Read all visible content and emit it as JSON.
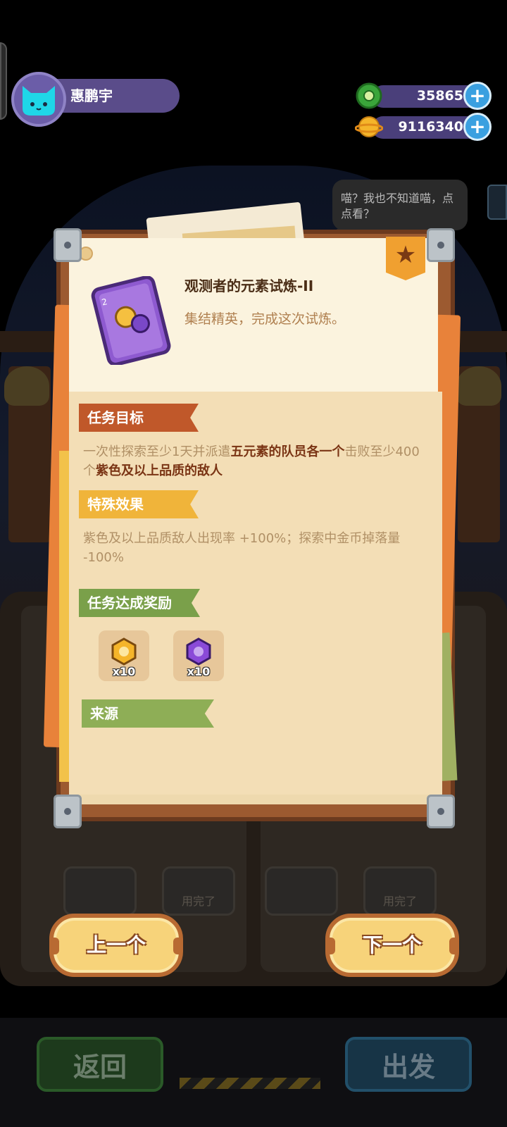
{
  "player": {
    "name": "惠鹏宇"
  },
  "resources": {
    "green_currency": {
      "value": "35865",
      "icon": "green-donut-coin-icon",
      "plus": "+"
    },
    "gold_currency": {
      "value": "9116340",
      "icon": "gold-planet-coin-icon",
      "plus": "+"
    }
  },
  "npc_speech": "喵？我也不知道喵，点点看？",
  "quest": {
    "title": "观测者的元素试炼-II",
    "description": "集结精英，完成这次试炼。",
    "badge_icon": "star-icon",
    "sections": {
      "objective": {
        "label": "任务目标",
        "text_part1": "一次性探索至少1天并派遣",
        "text_highlight1": "五元素的队员各一个",
        "text_part2": "击败至少400个",
        "text_highlight2": "紫色及以上品质的敌人"
      },
      "effect": {
        "label": "特殊效果",
        "text": "紫色及以上品质敌人出现率 +100%；探索中金币掉落量 -100%"
      },
      "reward": {
        "label": "任务达成奖励",
        "items": [
          {
            "icon": "gold-coin-token-icon",
            "qty": "x10"
          },
          {
            "icon": "purple-coin-token-icon",
            "qty": "x10"
          }
        ]
      },
      "source": {
        "label": "来源"
      }
    }
  },
  "background": {
    "card_labels": [
      "用完了",
      "用完了"
    ],
    "back_button": "返回",
    "depart_button": "出发"
  },
  "nav": {
    "prev_label": "上一个",
    "next_label": "下一个"
  },
  "colors": {
    "accent_orange": "#c0582a",
    "accent_yellow": "#f0b43a",
    "accent_green": "#7aa04a",
    "highlight_text": "#7a3414"
  }
}
